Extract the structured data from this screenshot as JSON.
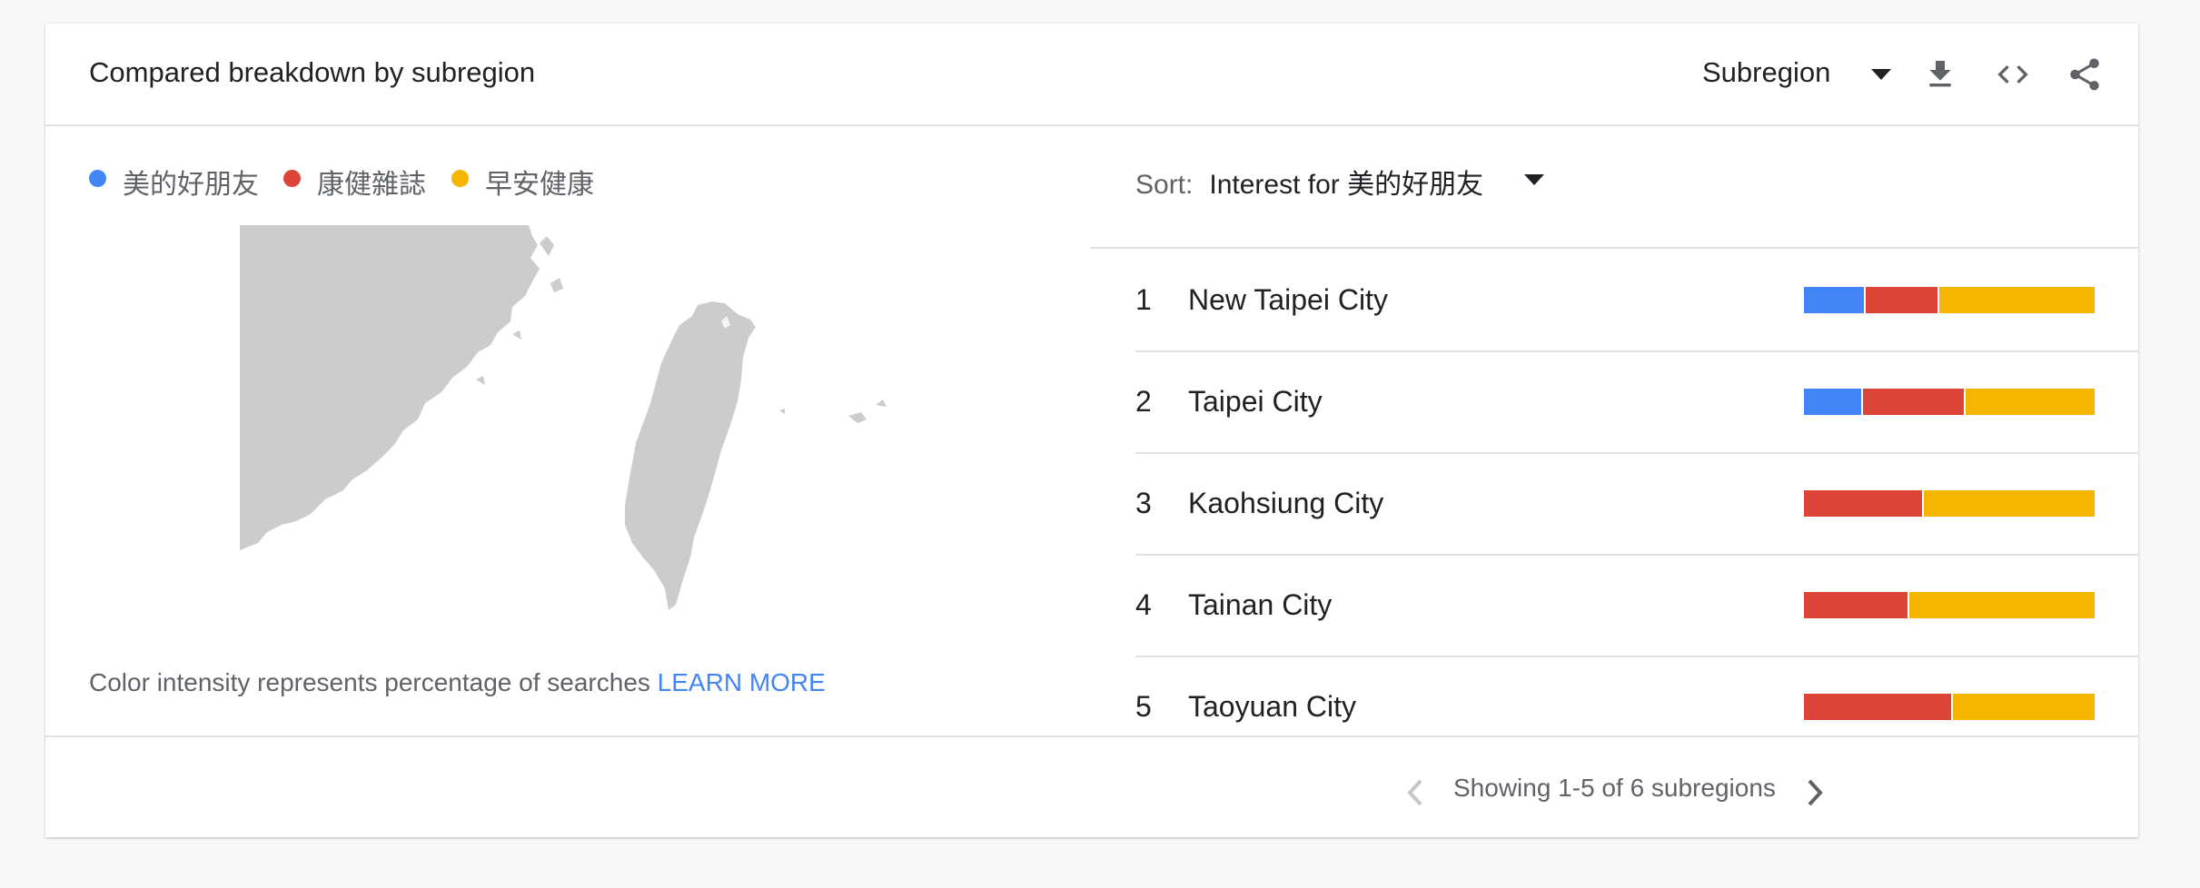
{
  "header": {
    "title": "Compared breakdown by subregion",
    "resolution_select": "Subregion",
    "icons": [
      "chevron-down-icon",
      "download-icon",
      "embed-code-icon",
      "share-icon"
    ]
  },
  "legend": [
    {
      "label": "美的好朋友",
      "color": "#4285f4"
    },
    {
      "label": "康健雜誌",
      "color": "#db4437"
    },
    {
      "label": "早安健康",
      "color": "#f4b400"
    }
  ],
  "map": {
    "icon": "taiwan-region-map"
  },
  "footnote": {
    "text": "Color intensity represents percentage of searches",
    "link": "LEARN MORE"
  },
  "sort": {
    "label": "Sort:",
    "value": "Interest for 美的好朋友"
  },
  "rows": [
    {
      "rank": "1",
      "region": "New Taipei City",
      "shares": [
        0.21,
        0.25,
        0.54
      ]
    },
    {
      "rank": "2",
      "region": "Taipei City",
      "shares": [
        0.2,
        0.35,
        0.45
      ]
    },
    {
      "rank": "3",
      "region": "Kaohsiung City",
      "shares": [
        0,
        0.41,
        0.59
      ]
    },
    {
      "rank": "4",
      "region": "Tainan City",
      "shares": [
        0,
        0.36,
        0.64
      ]
    },
    {
      "rank": "5",
      "region": "Taoyuan City",
      "shares": [
        0,
        0.51,
        0.49
      ]
    }
  ],
  "pagination": {
    "text": "Showing 1-5 of 6 subregions",
    "prev_icon": "chevron-left-icon",
    "next_icon": "chevron-right-icon"
  }
}
